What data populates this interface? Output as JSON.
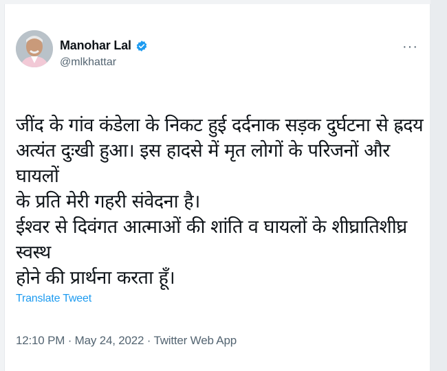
{
  "tweet": {
    "author": {
      "display_name": "Manohar Lal",
      "handle": "@mlkhattar",
      "verified": true,
      "avatar": "profile-photo"
    },
    "more_icon": "more-horizontal-icon",
    "text": "जींद के गांव कंडेला के निकट हुई दर्दनाक सड़क दुर्घटना से ह्रदय\nअत्यंत दुःखी हुआ। इस हादसे में मृत लोगों के परिजनों और घायलों\nके प्रति मेरी गहरी संवेदना है।\nईश्वर से दिवंगत आत्माओं की शांति व घायलों के शीघ्रातिशीघ्र स्वस्थ\nहोने की प्रार्थना करता हूँ।",
    "translate_label": "Translate Tweet",
    "meta": "12:10 PM · May 24, 2022 · Twitter Web App"
  },
  "colors": {
    "text": "#0f1419",
    "secondary": "#536471",
    "accent": "#1d9bf0",
    "background": "#ffffff"
  }
}
